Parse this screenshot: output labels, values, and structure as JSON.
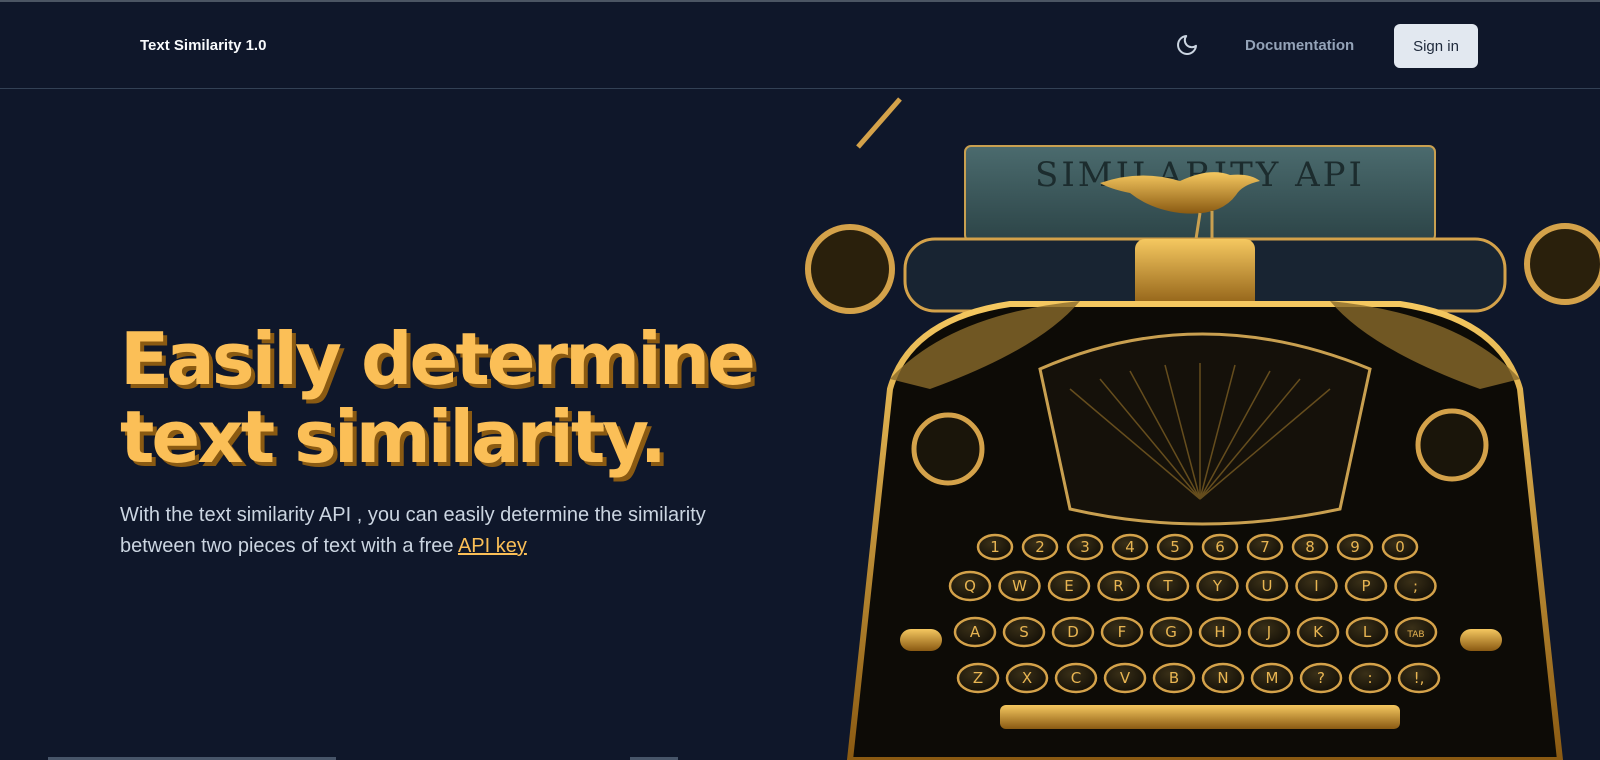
{
  "header": {
    "brand": "Text Similarity 1.0",
    "theme_icon": "moon-icon",
    "documentation_label": "Documentation",
    "signin_label": "Sign in"
  },
  "hero": {
    "headline_line1": "Easily determine",
    "headline_line2": "text similarity.",
    "description": "With the text similarity API , you can easily determine the similarity between two pieces of text with a free",
    "link_label": "API key",
    "image": {
      "paper_text": "SIMILARITY API",
      "number_row": [
        "1",
        "2",
        "3",
        "4",
        "5",
        "6",
        "7",
        "8",
        "9",
        "0"
      ],
      "top_row": [
        "Q",
        "W",
        "E",
        "R",
        "T",
        "Y",
        "U",
        "I",
        "P",
        ";"
      ],
      "middle_row": [
        "A",
        "S",
        "D",
        "F",
        "G",
        "H",
        "J",
        "K",
        "L",
        "TAB"
      ],
      "bottom_row": [
        "Z",
        "X",
        "C",
        "V",
        "B",
        "N",
        "M",
        "?",
        ":",
        "!,"
      ]
    }
  },
  "colors": {
    "background": "#0f172a",
    "accent": "#fbbf57",
    "accent_shadow": "#8a5a12",
    "gold": "#d4a24a",
    "paper": "#3b5a5e"
  }
}
